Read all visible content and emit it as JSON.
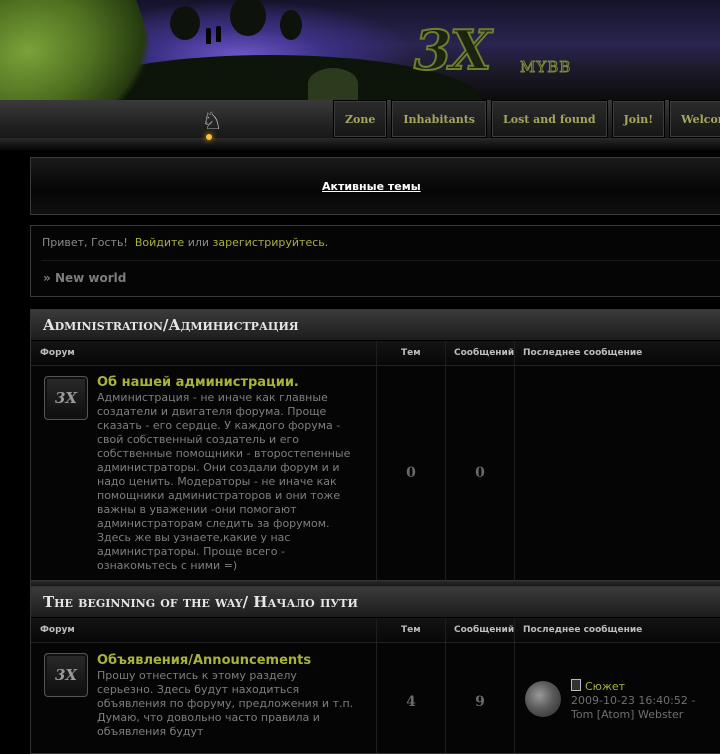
{
  "header": {
    "logo_main": "3X",
    "logo_sub": "MYBB"
  },
  "nav": [
    {
      "label": "Zone"
    },
    {
      "label": "Inhabitants"
    },
    {
      "label": "Lost and found"
    },
    {
      "label": "Join!"
    },
    {
      "label": "Welcome"
    }
  ],
  "active_topics": {
    "label": "Активные темы"
  },
  "welcome": {
    "greeting": "Привет, Гость!",
    "login_link": "Войдите",
    "or": "или",
    "register_link": "зарегистрируйтесь.",
    "breadcrumb_prefix": "»",
    "breadcrumb": "New world"
  },
  "columns": {
    "forum": "Форум",
    "topics": "Тем",
    "posts": "Сообщений",
    "last_post": "Последнее сообщение"
  },
  "categories": [
    {
      "title": "Administration/Администрация",
      "forums": [
        {
          "title": "Об нашей администрации.",
          "description": "Администрация - не иначе как главные создатели и двигателя форума. Проще сказать - его сердце. У каждого форума - свой собственный создатель и его собственные помощники - второстепенные администраторы. Они создали форум и и надо ценить. Модераторы - не иначе как помощники администраторов и они тоже важны в уважении -они помогают администраторам следить за форумом. Здесь же вы узнаете,какие у нас администраторы. Проще всего - ознакомьтесь с ними =)",
          "topics": "0",
          "posts": "0"
        }
      ]
    },
    {
      "title": "The beginning of the way/ Начало пути",
      "forums": [
        {
          "title": "Объявления/Announcements",
          "description": "Прошу отнестись к этому разделу серьезно. Здесь будут находиться объявления по форуму, предложения и т.п. Думаю, что довольно часто правила и объявления будут",
          "topics": "4",
          "posts": "9",
          "last_post": {
            "title": "Сюжет",
            "date": "2009-10-23 16:40:52 -",
            "author": "Tom [Atom] Webster"
          }
        }
      ]
    }
  ],
  "icons": {
    "forum_icon_text": "3X",
    "mascot": "♘"
  },
  "colors": {
    "accent": "#a8b33a",
    "nav_text": "#a4a65c",
    "background": "#000000"
  }
}
